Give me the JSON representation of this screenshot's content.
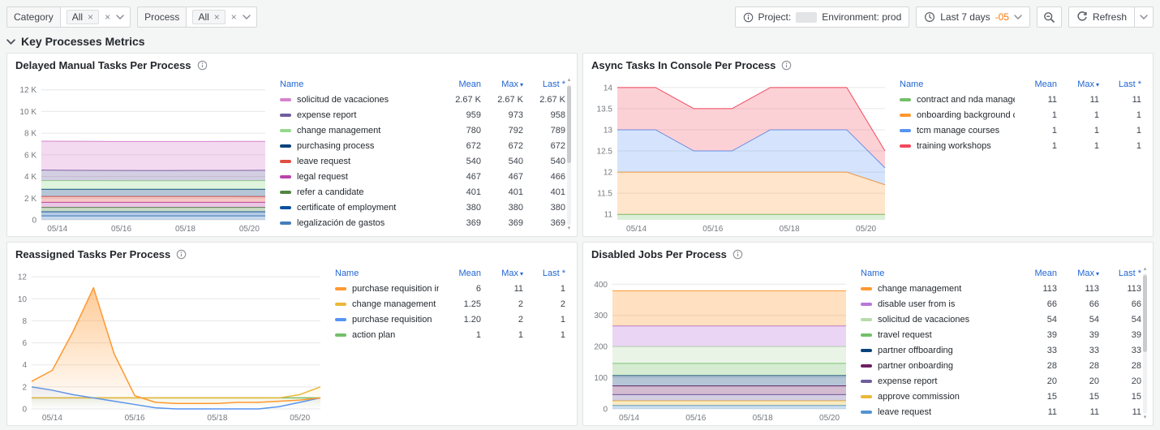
{
  "colors": {
    "page_background": "#F4F5F5",
    "panel_border": "#E2E3E5",
    "legend_header_blue": "#2166D3",
    "timezone_orange": "#FF780A",
    "gridline": "#E6E7E9"
  },
  "toolbar": {
    "filters": [
      {
        "label": "Category",
        "value": "All"
      },
      {
        "label": "Process",
        "value": "All"
      }
    ],
    "info_box": {
      "project_label": "Project:",
      "project_value": "",
      "environment_label": "Environment: prod"
    },
    "time_picker": {
      "label": "Last 7 days",
      "timezone": "-05"
    },
    "refresh_label": "Refresh"
  },
  "section": {
    "title": "Key Processes Metrics"
  },
  "legend_columns": {
    "name": "Name",
    "mean": "Mean",
    "max": "Max",
    "last": "Last *"
  },
  "panels": [
    {
      "title": "Delayed Manual Tasks Per Process",
      "legend_scrollbar": true,
      "legend_rows": [
        {
          "name": "solicitud de vacaciones",
          "color": "#D683CE",
          "mean": "2.67 K",
          "max": "2.67 K",
          "last": "2.67 K"
        },
        {
          "name": "expense report",
          "color": "#705DA0",
          "mean": "959",
          "max": "973",
          "last": "958"
        },
        {
          "name": "change management",
          "color": "#96D98D",
          "mean": "780",
          "max": "792",
          "last": "789"
        },
        {
          "name": "purchasing process",
          "color": "#0A437C",
          "mean": "672",
          "max": "672",
          "last": "672"
        },
        {
          "name": "leave request",
          "color": "#E24D42",
          "mean": "540",
          "max": "540",
          "last": "540"
        },
        {
          "name": "legal request",
          "color": "#BA43A9",
          "mean": "467",
          "max": "467",
          "last": "466"
        },
        {
          "name": "refer a candidate",
          "color": "#508642",
          "mean": "401",
          "max": "401",
          "last": "401"
        },
        {
          "name": "certificate of employment",
          "color": "#0A50A1",
          "mean": "380",
          "max": "380",
          "last": "380"
        },
        {
          "name": "legalización de gastos",
          "color": "#447EBC",
          "mean": "369",
          "max": "369",
          "last": "369"
        }
      ],
      "chart_data": {
        "type": "area",
        "stacked": true,
        "title": "Delayed Manual Tasks Per Process",
        "legend_position": "right-table",
        "ylim": [
          0,
          12800
        ],
        "y_tick_values": [
          0,
          2000,
          4000,
          6000,
          8000,
          10000,
          12000
        ],
        "y_tick_labels": [
          "0",
          "2 K",
          "4 K",
          "6 K",
          "8 K",
          "10 K",
          "12 K"
        ],
        "x_tick_frac": [
          0.0714,
          0.357,
          0.643,
          0.929
        ],
        "x_tick_labels": [
          "05/14",
          "05/16",
          "05/18",
          "05/20"
        ],
        "fill_opacity": 0.3,
        "series": [
          {
            "name": "legalización de gastos",
            "color": "#447EBC",
            "values": [
              369,
              369,
              369,
              369,
              369,
              369,
              369,
              369
            ]
          },
          {
            "name": "certificate of employment",
            "color": "#0A50A1",
            "values": [
              380,
              380,
              380,
              380,
              380,
              380,
              380,
              380
            ]
          },
          {
            "name": "refer a candidate",
            "color": "#508642",
            "values": [
              401,
              401,
              401,
              401,
              401,
              401,
              401,
              401
            ]
          },
          {
            "name": "legal request",
            "color": "#BA43A9",
            "values": [
              467,
              467,
              467,
              467,
              467,
              467,
              467,
              466
            ]
          },
          {
            "name": "leave request",
            "color": "#E24D42",
            "values": [
              540,
              540,
              540,
              540,
              540,
              540,
              540,
              540
            ]
          },
          {
            "name": "purchasing process",
            "color": "#0A437C",
            "values": [
              672,
              672,
              672,
              672,
              672,
              672,
              672,
              672
            ]
          },
          {
            "name": "change management",
            "color": "#96D98D",
            "values": [
              792,
              789,
              781,
              776,
              775,
              778,
              781,
              789
            ]
          },
          {
            "name": "expense report",
            "color": "#705DA0",
            "values": [
              973,
              962,
              957,
              954,
              956,
              958,
              959,
              958
            ]
          },
          {
            "name": "solicitud de vacaciones",
            "color": "#D683CE",
            "values": [
              2670,
              2670,
              2670,
              2670,
              2670,
              2670,
              2670,
              2670
            ]
          }
        ]
      }
    },
    {
      "title": "Async Tasks In Console Per Process",
      "legend_scrollbar": false,
      "legend_rows": [
        {
          "name": "contract and nda management",
          "color": "#73BF69",
          "mean": "11",
          "max": "11",
          "last": "11"
        },
        {
          "name": "onboarding background checks",
          "color": "#FF9830",
          "mean": "1",
          "max": "1",
          "last": "1"
        },
        {
          "name": "tcm manage courses",
          "color": "#5794F2",
          "mean": "1",
          "max": "1",
          "last": "1"
        },
        {
          "name": "training workshops",
          "color": "#F2495C",
          "mean": "1",
          "max": "1",
          "last": "1"
        }
      ],
      "chart_data": {
        "type": "area",
        "stacked": true,
        "title": "Async Tasks In Console Per Process",
        "legend_position": "right-table",
        "ylim": [
          10.87,
          14.15
        ],
        "y_tick_values": [
          11,
          11.5,
          12,
          12.5,
          13,
          13.5,
          14
        ],
        "y_tick_labels": [
          "11",
          "11.5",
          "12",
          "12.5",
          "13",
          "13.5",
          "14"
        ],
        "x_tick_frac": [
          0.0714,
          0.357,
          0.643,
          0.929
        ],
        "x_tick_labels": [
          "05/14",
          "05/16",
          "05/18",
          "05/20"
        ],
        "fill_opacity": 0.25,
        "series": [
          {
            "name": "contract and nda management",
            "color": "#73BF69",
            "values": [
              11,
              11,
              11,
              11,
              11,
              11,
              11,
              11
            ]
          },
          {
            "name": "onboarding background checks",
            "color": "#FF9830",
            "values": [
              1,
              1,
              1,
              1,
              1,
              1,
              1,
              0.7
            ]
          },
          {
            "name": "tcm manage courses",
            "color": "#5794F2",
            "values": [
              1,
              1,
              0.5,
              0.5,
              1,
              1,
              1,
              0.4
            ]
          },
          {
            "name": "training workshops",
            "color": "#F2495C",
            "values": [
              1,
              1,
              1,
              1,
              1,
              1,
              1,
              0.4
            ]
          }
        ]
      }
    },
    {
      "title": "Reassigned Tasks Per Process",
      "legend_scrollbar": false,
      "legend_rows": [
        {
          "name": "purchase requisition invoices",
          "color": "#FF9830",
          "mean": "6",
          "max": "11",
          "last": "1"
        },
        {
          "name": "change management",
          "color": "#EAB839",
          "mean": "1.25",
          "max": "2",
          "last": "2"
        },
        {
          "name": "purchase requisition",
          "color": "#5794F2",
          "mean": "1.20",
          "max": "2",
          "last": "1"
        },
        {
          "name": "action plan",
          "color": "#73BF69",
          "mean": "1",
          "max": "1",
          "last": "1"
        }
      ],
      "chart_data": {
        "type": "line",
        "stacked": false,
        "title": "Reassigned Tasks Per Process",
        "legend_position": "right-table",
        "ylim": [
          0,
          12.6
        ],
        "y_tick_values": [
          0,
          2,
          4,
          6,
          8,
          10,
          12
        ],
        "y_tick_labels": [
          "0",
          "2",
          "4",
          "6",
          "8",
          "10",
          "12"
        ],
        "x_tick_frac": [
          0.0714,
          0.357,
          0.643,
          0.929
        ],
        "x_tick_labels": [
          "05/14",
          "05/16",
          "05/18",
          "05/20"
        ],
        "series": [
          {
            "name": "action plan",
            "color": "#73BF69",
            "fill": 0.08,
            "values": [
              1,
              1,
              1,
              1,
              1,
              1,
              1,
              1,
              1,
              1,
              1,
              1,
              1,
              1,
              1
            ]
          },
          {
            "name": "change management",
            "color": "#EAB839",
            "fill": 0.1,
            "values": [
              1,
              1,
              1,
              1,
              1,
              1,
              1,
              1,
              1,
              1,
              1,
              1,
              1,
              1.3,
              2
            ]
          },
          {
            "name": "purchase requisition",
            "color": "#5794F2",
            "fill": 0.12,
            "values": [
              2,
              1.7,
              1.3,
              1,
              0.7,
              0.4,
              0.1,
              0,
              0,
              0,
              0,
              0,
              0.2,
              0.6,
              1
            ]
          },
          {
            "name": "purchase requisition invoices",
            "color": "#FF9830",
            "fill": 0.5,
            "values": [
              2.5,
              3.5,
              7,
              11,
              5,
              1.2,
              0.6,
              0.5,
              0.5,
              0.5,
              0.6,
              0.6,
              0.7,
              0.8,
              1
            ]
          }
        ]
      }
    },
    {
      "title": "Disabled Jobs Per Process",
      "legend_scrollbar": true,
      "legend_rows": [
        {
          "name": "change management",
          "color": "#FF9830",
          "mean": "113",
          "max": "113",
          "last": "113"
        },
        {
          "name": "disable user from is",
          "color": "#B877D9",
          "mean": "66",
          "max": "66",
          "last": "66"
        },
        {
          "name": "solicitud de vacaciones",
          "color": "#B7DBAB",
          "mean": "54",
          "max": "54",
          "last": "54"
        },
        {
          "name": "travel request",
          "color": "#73BF69",
          "mean": "39",
          "max": "39",
          "last": "39"
        },
        {
          "name": "partner offboarding",
          "color": "#0A437C",
          "mean": "33",
          "max": "33",
          "last": "33"
        },
        {
          "name": "partner onboarding",
          "color": "#6D1F62",
          "mean": "28",
          "max": "28",
          "last": "28"
        },
        {
          "name": "expense report",
          "color": "#705DA0",
          "mean": "20",
          "max": "20",
          "last": "20"
        },
        {
          "name": "approve commission",
          "color": "#EAB839",
          "mean": "15",
          "max": "15",
          "last": "15"
        },
        {
          "name": "leave request",
          "color": "#5195CE",
          "mean": "11",
          "max": "11",
          "last": "11"
        }
      ],
      "chart_data": {
        "type": "area",
        "stacked": true,
        "title": "Disabled Jobs Per Process",
        "legend_position": "right-table",
        "ylim": [
          0,
          445
        ],
        "y_tick_values": [
          0,
          100,
          200,
          300,
          400
        ],
        "y_tick_labels": [
          "0",
          "100",
          "200",
          "300",
          "400"
        ],
        "x_tick_frac": [
          0.0714,
          0.357,
          0.643,
          0.929
        ],
        "x_tick_labels": [
          "05/14",
          "05/16",
          "05/18",
          "05/20"
        ],
        "fill_opacity": 0.3,
        "series": [
          {
            "name": "leave request",
            "color": "#5195CE",
            "values": [
              11,
              11,
              11,
              11,
              11,
              11,
              11,
              11
            ]
          },
          {
            "name": "approve commission",
            "color": "#EAB839",
            "values": [
              15,
              15,
              15,
              15,
              15,
              15,
              15,
              15
            ]
          },
          {
            "name": "expense report",
            "color": "#705DA0",
            "values": [
              20,
              20,
              20,
              20,
              20,
              20,
              20,
              20
            ]
          },
          {
            "name": "partner onboarding",
            "color": "#6D1F62",
            "values": [
              28,
              28,
              28,
              28,
              28,
              28,
              28,
              28
            ]
          },
          {
            "name": "partner offboarding",
            "color": "#0A437C",
            "values": [
              33,
              33,
              33,
              33,
              33,
              33,
              33,
              33
            ]
          },
          {
            "name": "travel request",
            "color": "#73BF69",
            "values": [
              39,
              39,
              39,
              39,
              39,
              39,
              39,
              39
            ]
          },
          {
            "name": "solicitud de vacaciones",
            "color": "#B7DBAB",
            "values": [
              54,
              54,
              54,
              54,
              54,
              54,
              54,
              54
            ]
          },
          {
            "name": "disable user from is",
            "color": "#B877D9",
            "values": [
              66,
              66,
              66,
              66,
              66,
              66,
              66,
              66
            ]
          },
          {
            "name": "change management",
            "color": "#FF9830",
            "values": [
              113,
              113,
              113,
              113,
              113,
              113,
              113,
              113
            ]
          }
        ]
      }
    }
  ]
}
